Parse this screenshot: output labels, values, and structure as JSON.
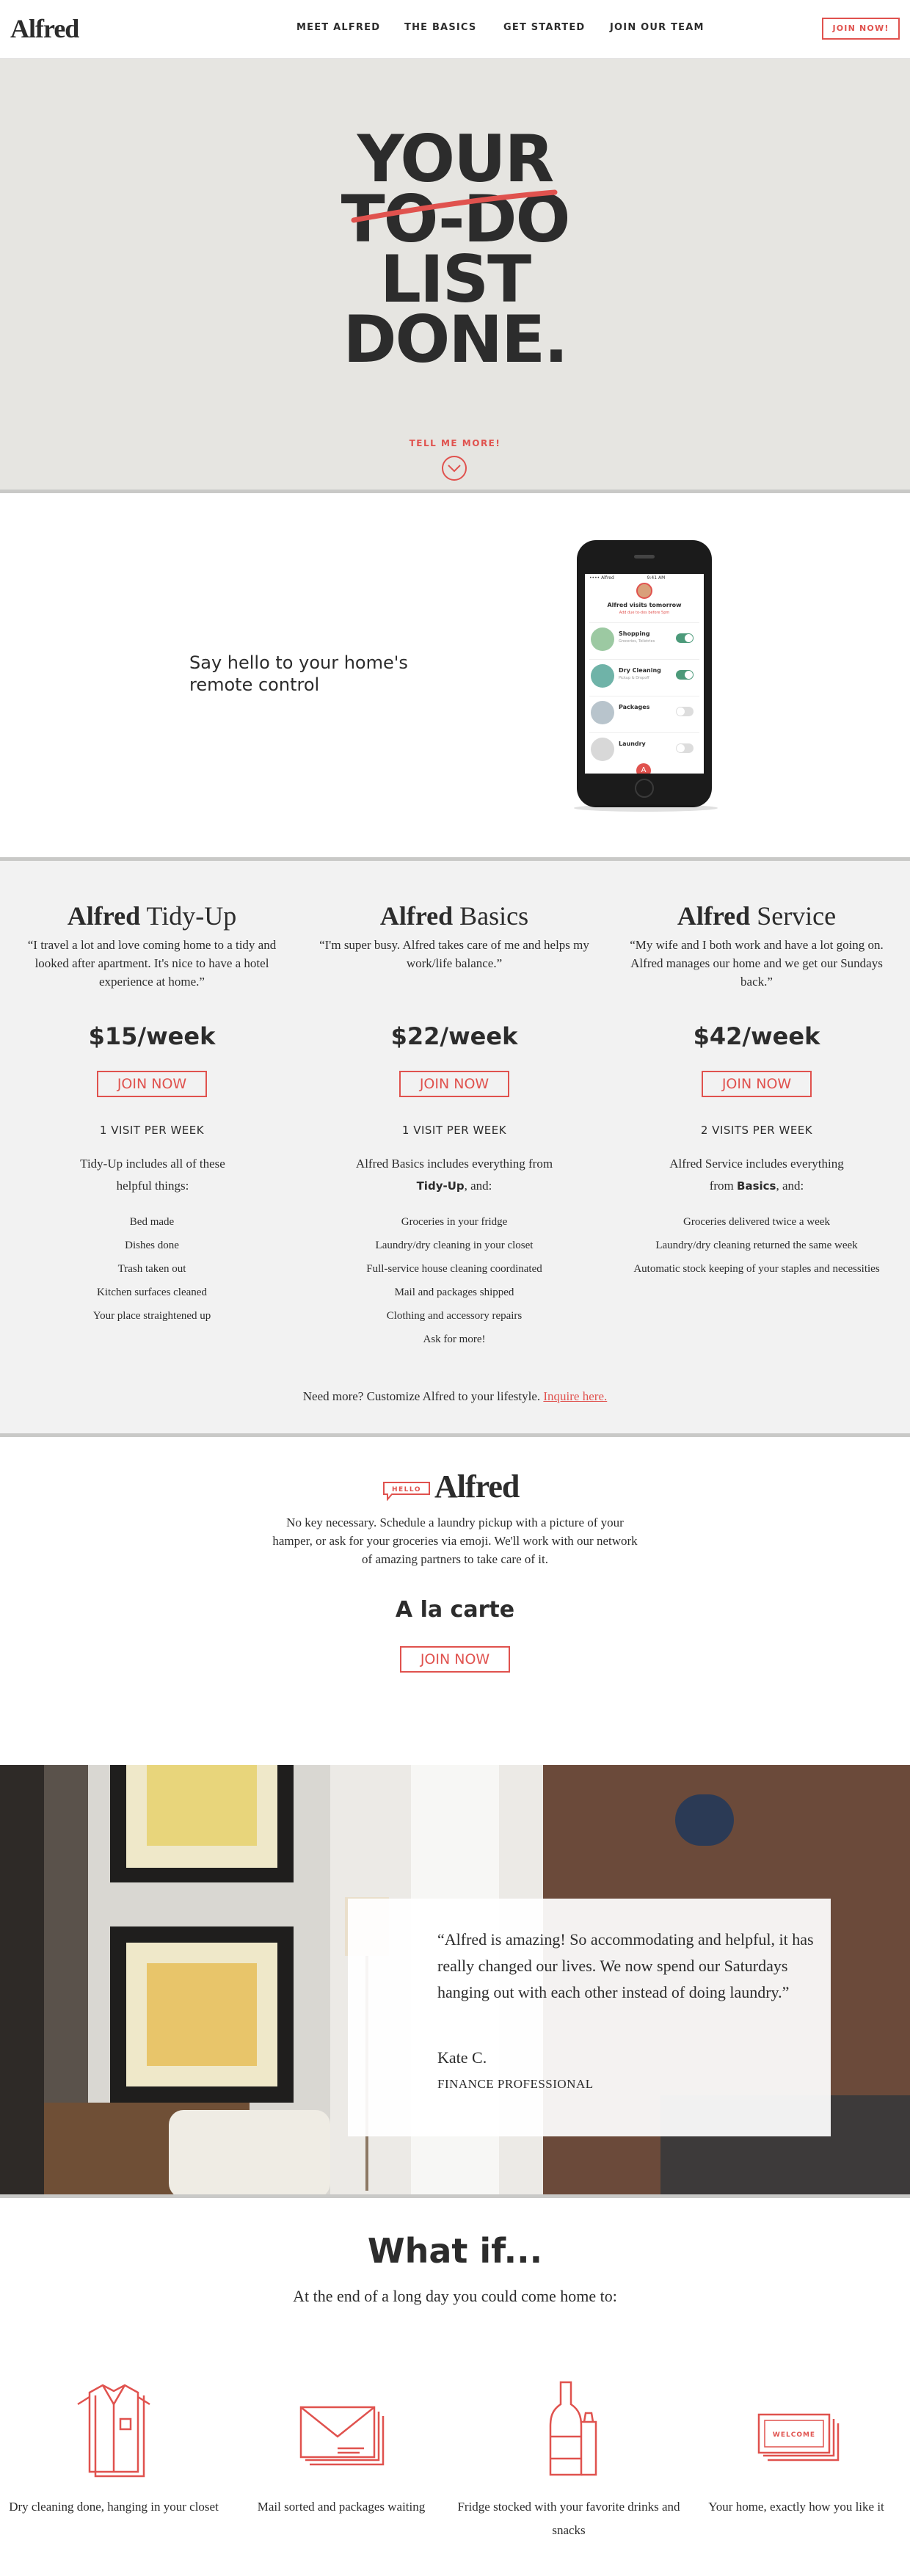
{
  "header": {
    "logo": "Alfred",
    "nav": [
      "MEET ALFRED",
      "THE BASICS",
      "GET STARTED",
      "JOIN OUR TEAM"
    ],
    "join_label": "JOIN NOW!"
  },
  "hero": {
    "line1": "YOUR",
    "line2": "TO-DO",
    "line3": "LIST",
    "line4": "DONE.",
    "tell_label": "TELL ME MORE!"
  },
  "remote": {
    "text": "Say hello to your home's remote control",
    "phone": {
      "status_left": "•••• Alfred",
      "status_center": "9:41 AM",
      "visit_title": "Alfred visits tomorrow",
      "visit_sub": "Add due to-dos before 5pm",
      "items": [
        {
          "label": "Shopping",
          "sub": "Groceries, Toiletries",
          "on": true,
          "color": "#9cc9a2"
        },
        {
          "label": "Dry Cleaning",
          "sub": "Pickup & Dropoff",
          "on": true,
          "color": "#6fb3a8"
        },
        {
          "label": "Packages",
          "sub": "",
          "on": false,
          "color": "#b8c4cc"
        },
        {
          "label": "Laundry",
          "sub": "",
          "on": false,
          "color": "#d8d8d8"
        }
      ],
      "toggle_on_color": "#4c9a7a"
    }
  },
  "plans": {
    "items": [
      {
        "brand": "Alfred",
        "name": "Tidy-Up",
        "quote": "“I travel a lot and love coming home to a tidy and looked after apartment. It's nice to have a hotel experience at home.”",
        "price": "$15/week",
        "join_label": "JOIN NOW",
        "visits": "1 VISIT PER WEEK",
        "intro_a": "Tidy-Up includes all of these helpful things:",
        "intro_b": "",
        "intro_c": "",
        "features": [
          "Bed made",
          "Dishes done",
          "Trash taken out",
          "Kitchen surfaces cleaned",
          "Your place straightened up"
        ]
      },
      {
        "brand": "Alfred",
        "name": "Basics",
        "quote": "“I'm super busy. Alfred takes care of me and helps my work/life balance.”",
        "price": "$22/week",
        "join_label": "JOIN NOW",
        "visits": "1 VISIT PER WEEK",
        "intro_a": "Alfred Basics includes everything from ",
        "intro_b": "Tidy-Up",
        "intro_c": ", and:",
        "features": [
          "Groceries in your fridge",
          "Laundry/dry cleaning in your closet",
          "Full-service house cleaning coordinated",
          "Mail and packages shipped",
          "Clothing and accessory repairs",
          "Ask for more!"
        ]
      },
      {
        "brand": "Alfred",
        "name": "Service",
        "quote": "“My wife and I both work and have a lot going on. Alfred manages our home and we get our Sundays back.”",
        "price": "$42/week",
        "join_label": "JOIN NOW",
        "visits": "2 VISITS PER WEEK",
        "intro_a": "Alfred Service includes everything from ",
        "intro_b": "Basics",
        "intro_c": ", and:",
        "features": [
          "Groceries delivered twice a week",
          "Laundry/dry cleaning returned the same week",
          "Automatic stock keeping of your staples and necessities"
        ]
      }
    ],
    "need_more": "Need more? Customize Alfred to your lifestyle. ",
    "inquire": "Inquire here."
  },
  "hello": {
    "badge": "HELLO",
    "title": "Alfred",
    "desc": "No key necessary. Schedule a laundry pickup with a picture of your hamper, or ask for your groceries via emoji. We'll work with our network of amazing partners to take care of it.",
    "carte_title": "A la carte",
    "join_label": "JOIN NOW"
  },
  "testimonial": {
    "quote": "“Alfred is amazing! So accommodating and helpful, it has really changed our lives. We now spend our Saturdays hanging out with each other instead of doing laundry.”",
    "name": "Kate C.",
    "role": "FINANCE PROFESSIONAL"
  },
  "whatif": {
    "title": "What if...",
    "subtitle": "At the end of a long day you could come home to:",
    "features": [
      {
        "icon": "shirt-icon",
        "label": "Dry cleaning done, hanging in your closet"
      },
      {
        "icon": "envelope-icon",
        "label": "Mail sorted and packages waiting"
      },
      {
        "icon": "bottle-icon",
        "label": "Fridge stocked with your favorite drinks and snacks"
      },
      {
        "icon": "welcome-mat-icon",
        "label": "Your home, exactly how you like it"
      }
    ],
    "welcome_mat_text": "WELCOME"
  },
  "colors": {
    "accent": "#e0524e",
    "hero_bg": "#e6e5e1",
    "plans_bg": "#f2f2f2",
    "text": "#2c2c2c"
  }
}
